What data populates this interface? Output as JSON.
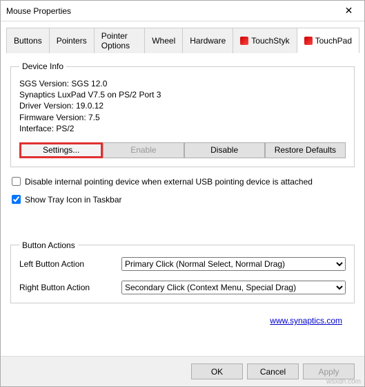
{
  "window_title": "Mouse Properties",
  "tabs": [
    "Buttons",
    "Pointers",
    "Pointer Options",
    "Wheel",
    "Hardware",
    "TouchStyk",
    "TouchPad"
  ],
  "active_tab": 6,
  "device_info": {
    "legend": "Device Info",
    "lines": [
      "SGS Version: SGS 12.0",
      "Synaptics LuxPad V7.5 on PS/2 Port 3",
      "Driver Version: 19.0.12",
      "Firmware Version: 7.5",
      "Interface: PS/2"
    ],
    "buttons": {
      "settings": "Settings...",
      "enable": "Enable",
      "disable": "Disable",
      "restore": "Restore Defaults"
    }
  },
  "checks": {
    "disable_internal": {
      "label": "Disable internal pointing device when external USB pointing device is attached",
      "checked": false
    },
    "show_tray": {
      "label": "Show Tray Icon in Taskbar",
      "checked": true
    }
  },
  "button_actions": {
    "legend": "Button Actions",
    "left_label": "Left Button Action",
    "left_value": "Primary Click (Normal Select, Normal Drag)",
    "right_label": "Right Button Action",
    "right_value": "Secondary Click (Context Menu, Special Drag)"
  },
  "link": "www.synaptics.com",
  "dialog_buttons": {
    "ok": "OK",
    "cancel": "Cancel",
    "apply": "Apply"
  },
  "watermark": "wsxdn.com"
}
